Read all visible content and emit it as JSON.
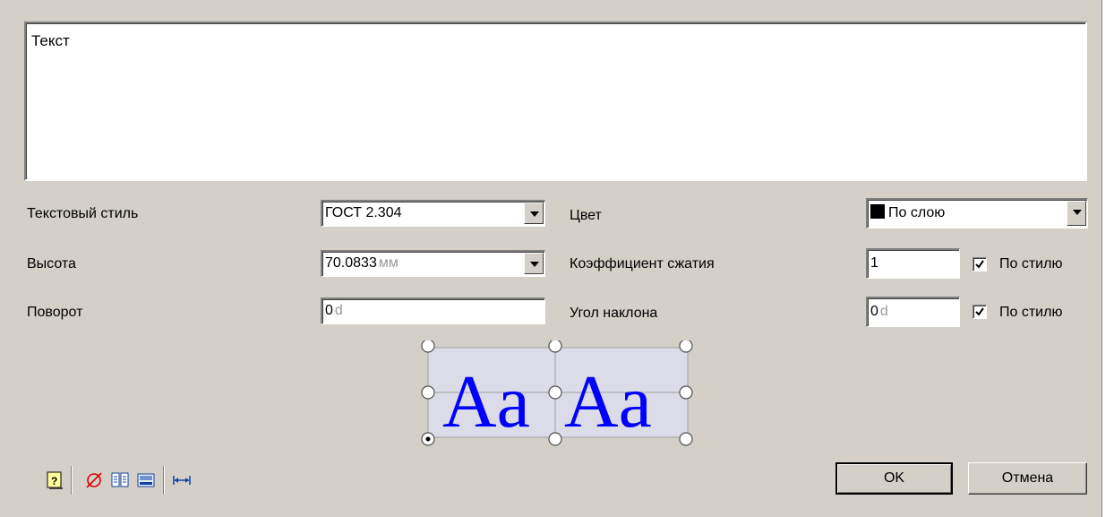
{
  "text_area": {
    "value": "Текст"
  },
  "fields": {
    "text_style": {
      "label": "Текстовый стиль",
      "value": "ГОСТ 2.304"
    },
    "height": {
      "label": "Высота",
      "value": "70.0833",
      "unit": "мм"
    },
    "rotation": {
      "label": "Поворот",
      "value": "0",
      "unit": "d"
    },
    "color": {
      "label": "Цвет",
      "value": "По слою",
      "swatch": "#000000"
    },
    "width_factor": {
      "label": "Коэффициент сжатия",
      "value": "1",
      "by_style_label": "По стилю",
      "by_style_checked": true
    },
    "oblique": {
      "label": "Угол наклона",
      "value": "0",
      "unit": "d",
      "by_style_label": "По стилю",
      "by_style_checked": true
    }
  },
  "preview": {
    "sample": "Aa",
    "text_color": "#0000ff"
  },
  "toolbar": {
    "icons": [
      "help-icon",
      "diameter-icon",
      "book-icon",
      "keyboard-icon",
      "width-arrows-icon"
    ]
  },
  "buttons": {
    "ok": "OK",
    "cancel": "Отмена"
  }
}
